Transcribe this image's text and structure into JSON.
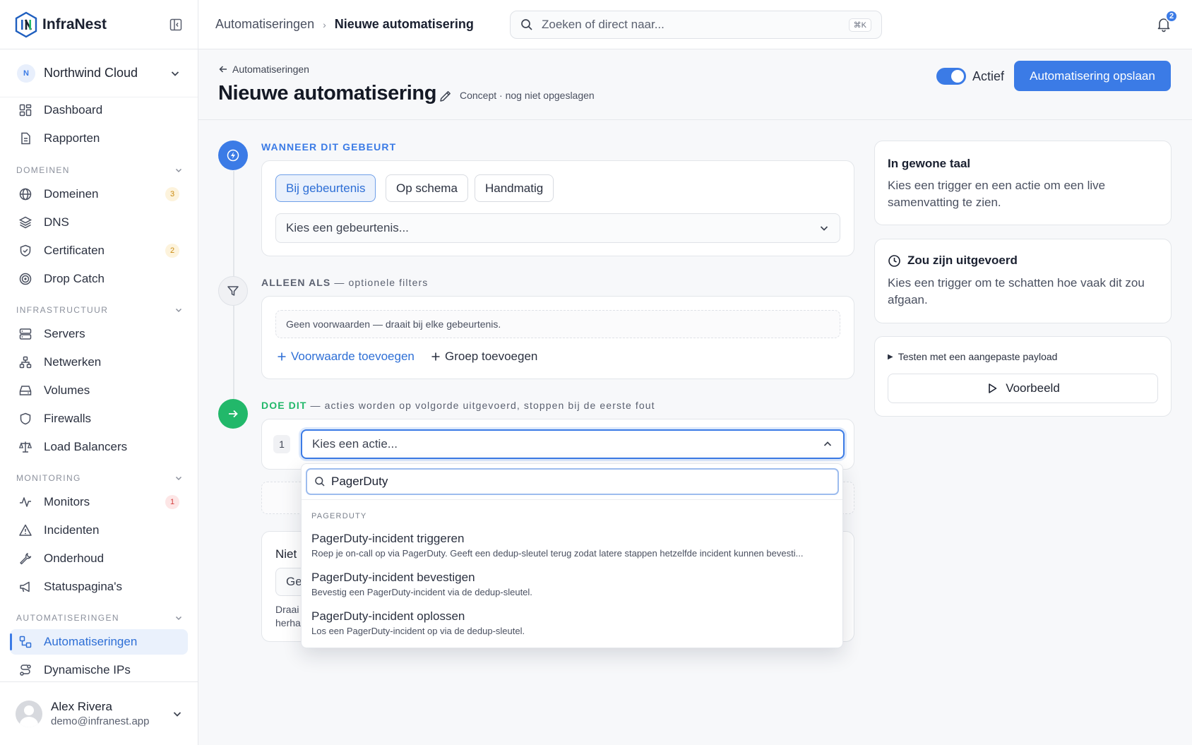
{
  "brand": {
    "name": "InfraNest"
  },
  "org": {
    "initial": "N",
    "name": "Northwind Cloud"
  },
  "nav": {
    "dashboard": "Dashboard",
    "reports": "Rapporten",
    "sec_domains": "DOMEINEN",
    "domains": "Domeinen",
    "domains_badge": "3",
    "dns": "DNS",
    "certs": "Certificaten",
    "certs_badge": "2",
    "dropcatch": "Drop Catch",
    "sec_infra": "INFRASTRUCTUUR",
    "servers": "Servers",
    "networks": "Netwerken",
    "volumes": "Volumes",
    "firewalls": "Firewalls",
    "lbs": "Load Balancers",
    "sec_monitoring": "MONITORING",
    "monitors": "Monitors",
    "monitors_badge": "1",
    "incidents": "Incidenten",
    "maintenance": "Onderhoud",
    "statuspages": "Statuspagina's",
    "sec_automations": "AUTOMATISERINGEN",
    "automations": "Automatiseringen",
    "dynips": "Dynamische IPs"
  },
  "user": {
    "name": "Alex Rivera",
    "email": "demo@infranest.app"
  },
  "topbar": {
    "crumb_parent": "Automatiseringen",
    "crumb_current": "Nieuwe automatisering",
    "search_placeholder": "Zoeken of direct naar...",
    "search_kbd": "⌘K",
    "notifications": "2"
  },
  "header": {
    "back": "Automatiseringen",
    "title": "Nieuwe automatisering",
    "status": "Concept · nog niet opgeslagen",
    "toggle_label": "Actief",
    "save": "Automatisering opslaan"
  },
  "trigger": {
    "title": "WANNEER DIT GEBEURT",
    "tabs": [
      "Bij gebeurtenis",
      "Op schema",
      "Handmatig"
    ],
    "select_placeholder": "Kies een gebeurtenis..."
  },
  "filters": {
    "title": "ALLEEN ALS",
    "subtitle": "— optionele filters",
    "empty": "Geen voorwaarden — draait bij elke gebeurtenis.",
    "add_condition": "Voorwaarde toevoegen",
    "add_group": "Groep toevoegen"
  },
  "actions": {
    "title": "DOE DIT",
    "subtitle": "— acties worden op volgorde uitgevoerd, stoppen bij de eerste fout",
    "step_number": "1",
    "select_placeholder": "Kies een actie...",
    "partial_label": "Niet",
    "partial_select": "Ge",
    "partial_help_1": "Draai",
    "partial_help_2": "herha"
  },
  "dropdown": {
    "search_value": "PagerDuty",
    "group": "PAGERDUTY",
    "options": [
      {
        "title": "PagerDuty-incident triggeren",
        "desc": "Roep je on-call op via PagerDuty. Geeft een dedup-sleutel terug zodat latere stappen hetzelfde incident kunnen bevesti..."
      },
      {
        "title": "PagerDuty-incident bevestigen",
        "desc": "Bevestig een PagerDuty-incident via de dedup-sleutel."
      },
      {
        "title": "PagerDuty-incident oplossen",
        "desc": "Los een PagerDuty-incident op via de dedup-sleutel."
      }
    ]
  },
  "panel": {
    "plain_title": "In gewone taal",
    "plain_text": "Kies een trigger en een actie om een live samenvatting te zien.",
    "would_title": "Zou zijn uitgevoerd",
    "would_text": "Kies een trigger om te schatten hoe vaak dit zou afgaan.",
    "test_label": "Testen met een aangepaste payload",
    "preview": "Voorbeeld"
  },
  "colors": {
    "accent": "#3b7be6",
    "success": "#22b86a"
  }
}
